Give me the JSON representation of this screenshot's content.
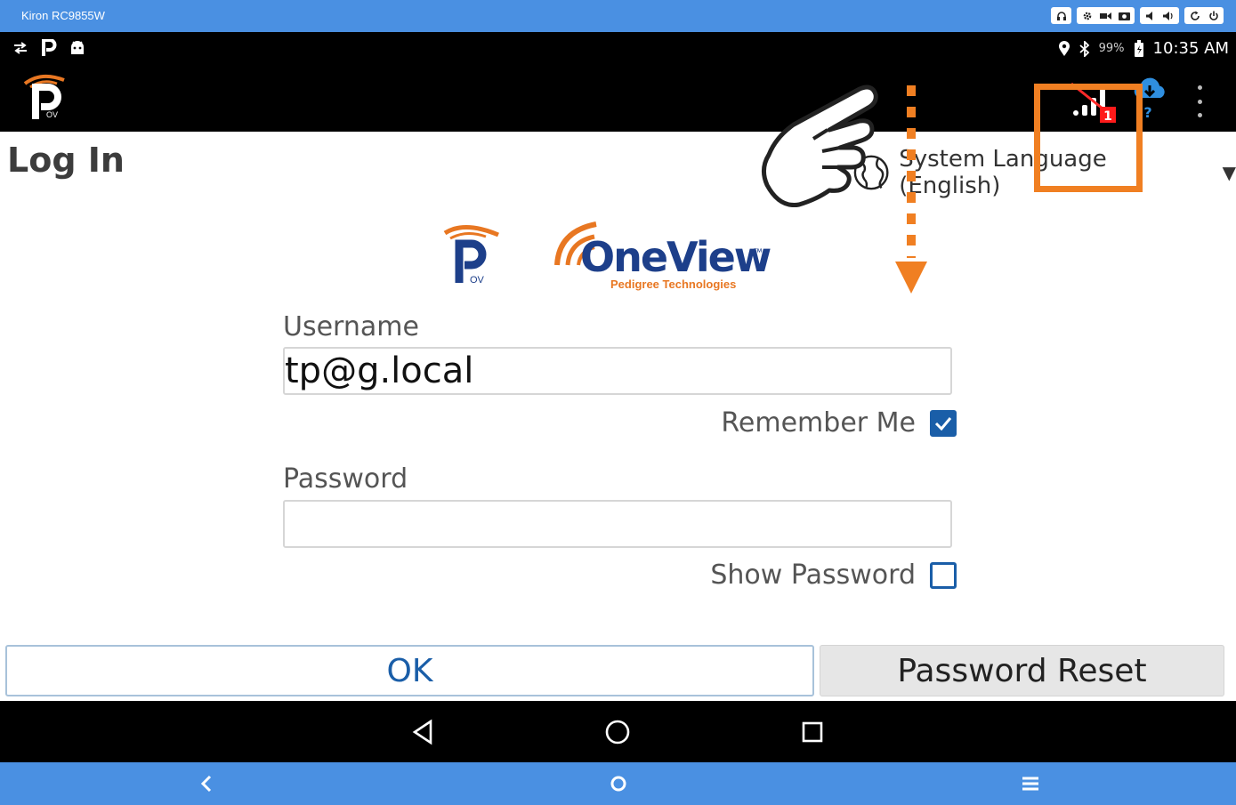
{
  "emulator": {
    "title": "Kiron RC9855W"
  },
  "status_bar": {
    "battery": "99%",
    "time": "10:35 AM"
  },
  "action_bar": {
    "sync_badge": "?",
    "signal_badge": "1"
  },
  "page": {
    "title": "Log In",
    "language_label": "System Language (English)"
  },
  "logo": {
    "brand_name": "OneView",
    "brand_subtitle": "Pedigree Technologies",
    "tm": "™",
    "pov": "OV"
  },
  "form": {
    "username_label": "Username",
    "username_value": "tp@g.local",
    "remember_label": "Remember Me",
    "remember_checked": true,
    "password_label": "Password",
    "password_value": "",
    "show_password_label": "Show Password",
    "show_password_checked": false
  },
  "buttons": {
    "ok": "OK",
    "reset": "Password Reset"
  },
  "colors": {
    "emulator_blue": "#4a90e2",
    "accent_blue": "#1a5ea8",
    "highlight_orange": "#f07f22"
  }
}
